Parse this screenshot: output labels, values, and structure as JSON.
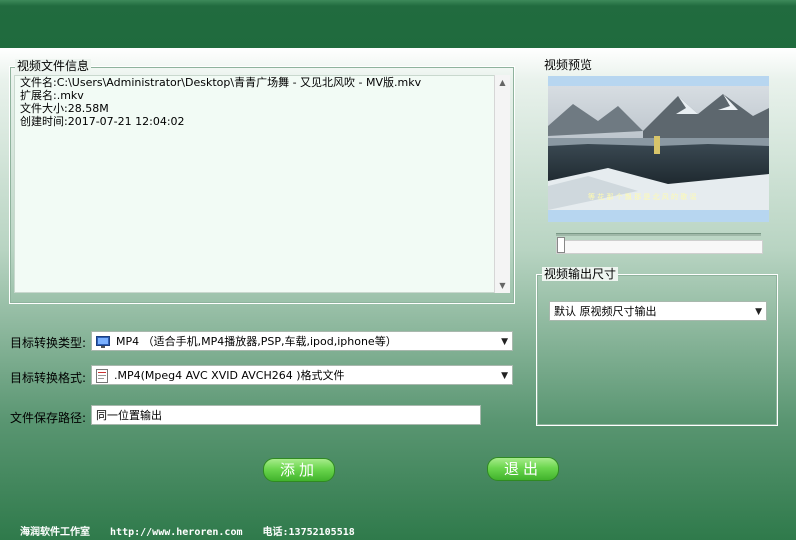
{
  "info": {
    "legend": "视频文件信息",
    "lines": [
      "文件名:C:\\Users\\Administrator\\Desktop\\青青广场舞 - 又见北风吹 - MV版.mkv",
      "扩展名:.mkv",
      "文件大小:28.58M",
      "创建时间:2017-07-21 12:04:02"
    ]
  },
  "preview": {
    "legend": "视频预览",
    "subtitle": "等 花 那 个 飘 那 是 北 风 的 歌 谣",
    "progress": 0
  },
  "size": {
    "legend": "视频输出尺寸",
    "selected": "默认   原视频尺寸输出"
  },
  "form": {
    "type_label": "目标转换类型:",
    "type_value": "MP4  （适合手机,MP4播放器,PSP,车载,ipod,iphone等）",
    "format_label": "目标转换格式:",
    "format_value": ".MP4(Mpeg4 AVC XVID AVCH264 )格式文件",
    "path_label": "文件保存路径:",
    "path_value": "同一位置输出"
  },
  "buttons": {
    "add": "添加",
    "exit": "退出"
  },
  "footer": {
    "studio": "海润软件工作室",
    "url": "http://www.heroren.com",
    "phone": "电话:13752105518"
  },
  "colors": {
    "titlebar": "#1f6b3d",
    "button": "#6bd64e"
  },
  "icons": {
    "type": "monitor-icon",
    "format": "document-icon"
  }
}
